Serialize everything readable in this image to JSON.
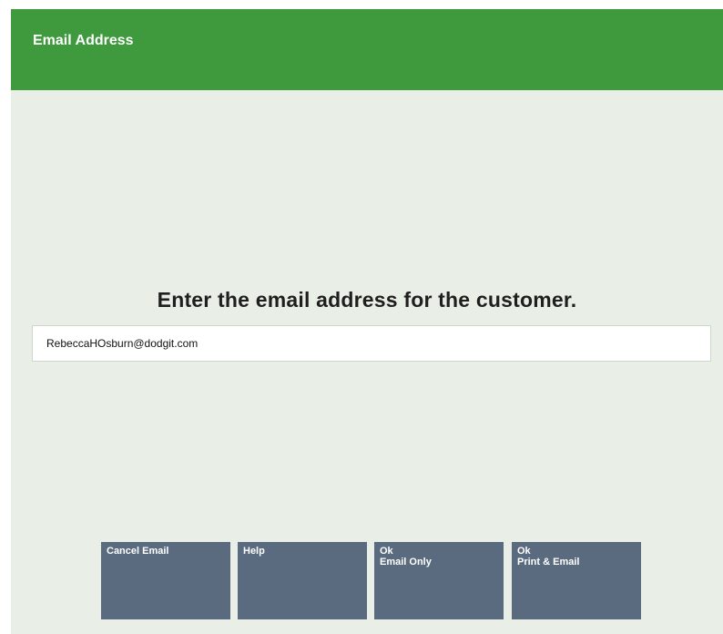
{
  "header": {
    "title": "Email Address"
  },
  "main": {
    "prompt": "Enter the email address for the customer.",
    "email_input": {
      "value": "RebeccaHOsburn@dodgit.com"
    }
  },
  "buttons": {
    "cancel_email": {
      "line1": "Cancel Email",
      "line2": ""
    },
    "help": {
      "line1": "Help",
      "line2": ""
    },
    "ok_email_only": {
      "line1": "Ok",
      "line2": "Email Only"
    },
    "ok_print_email": {
      "line1": "Ok",
      "line2": "Print & Email"
    }
  },
  "colors": {
    "header_bg": "#3e9a3c",
    "content_bg": "#e9efe6",
    "button_bg": "#5a6b80"
  }
}
